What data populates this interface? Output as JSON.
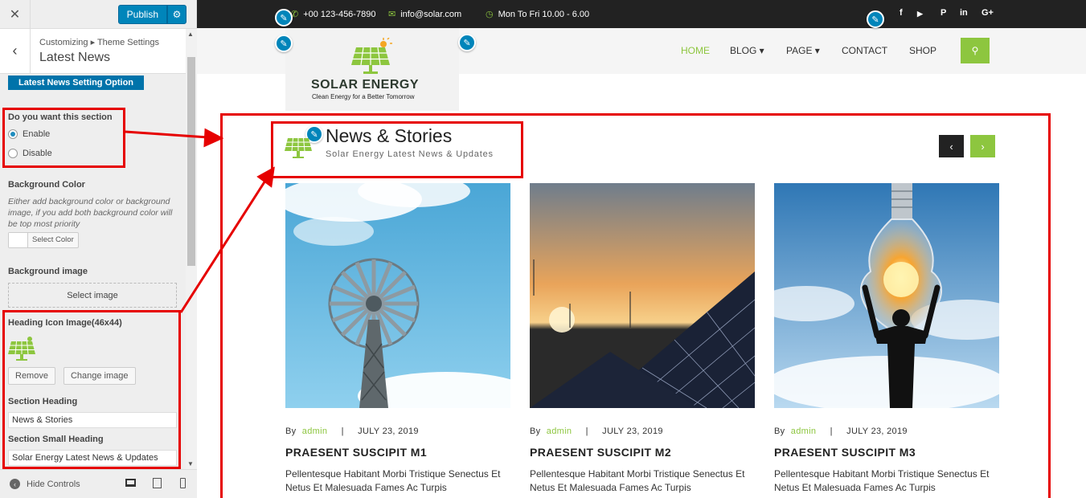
{
  "customizer": {
    "close_icon": "close-icon",
    "publish_label": "Publish",
    "breadcrumb": "Customizing ▸ Theme Settings",
    "panel_title": "Latest News",
    "setting_option_label": "Latest News Setting Option",
    "section_toggle": {
      "label": "Do you want this section",
      "options": [
        "Enable",
        "Disable"
      ],
      "selected": "Enable"
    },
    "background_color": {
      "label": "Background Color",
      "description": "Either add background color or background image, if you add both background color will be top most priority",
      "button": "Select Color"
    },
    "background_image": {
      "label": "Background image",
      "button": "Select image"
    },
    "heading_icon": {
      "label": "Heading Icon Image(46x44)",
      "remove": "Remove",
      "change": "Change image"
    },
    "section_heading": {
      "label": "Section Heading",
      "value": "News & Stories"
    },
    "section_small_heading": {
      "label": "Section Small Heading",
      "value": "Solar Energy Latest News & Updates"
    },
    "footer": {
      "hide_controls": "Hide Controls"
    }
  },
  "preview": {
    "topbar": {
      "phone": "+00 123-456-7890",
      "email": "info@solar.com",
      "hours": "Mon To Fri 10.00 - 6.00",
      "social": [
        "f",
        "▶",
        "P",
        "in",
        "G+"
      ]
    },
    "logo": {
      "title": "SOLAR ENERGY",
      "tagline": "Clean Energy for a Better Tomorrow"
    },
    "nav": [
      "HOME",
      "BLOG ▾",
      "PAGE ▾",
      "CONTACT",
      "SHOP"
    ],
    "news": {
      "title": "News & Stories",
      "subtitle": "Solar Energy Latest News & Updates",
      "posts": [
        {
          "by": "By",
          "author": "admin",
          "sep": "|",
          "date": "JULY 23, 2019",
          "title": "PRAESENT SUSCIPIT M1",
          "excerpt": "Pellentesque Habitant Morbi Tristique Senectus Et Netus Et Malesuada Fames Ac Turpis"
        },
        {
          "by": "By",
          "author": "admin",
          "sep": "|",
          "date": "JULY 23, 2019",
          "title": "PRAESENT SUSCIPIT M2",
          "excerpt": "Pellentesque Habitant Morbi Tristique Senectus Et Netus Et Malesuada Fames Ac Turpis"
        },
        {
          "by": "By",
          "author": "admin",
          "sep": "|",
          "date": "JULY 23, 2019",
          "title": "PRAESENT SUSCIPIT M3",
          "excerpt": "Pellentesque Habitant Morbi Tristique Senectus Et Netus Et Malesuada Fames Ac Turpis"
        }
      ]
    }
  },
  "colors": {
    "accent": "#8dc63f",
    "wp_blue": "#0085ba",
    "highlight": "#e60000",
    "topbar": "#222222"
  }
}
